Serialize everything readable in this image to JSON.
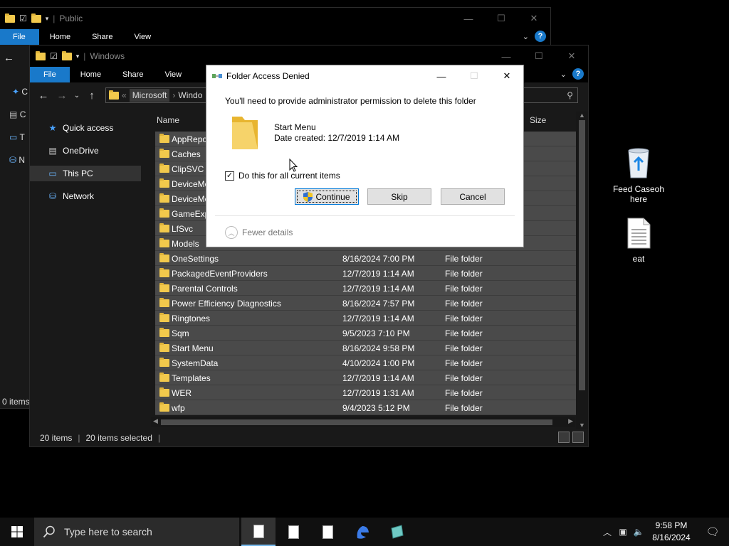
{
  "back_window": {
    "title": "Public",
    "ribbon": [
      "File",
      "Home",
      "Share",
      "View"
    ],
    "side_glyphs": [
      "C",
      "C",
      "T",
      "N"
    ],
    "status_text": "0 items"
  },
  "front_window": {
    "title": "Windows",
    "ribbon": [
      "File",
      "Home",
      "Share",
      "View"
    ],
    "address": {
      "sep": "«",
      "seg1": "Microsoft",
      "seg2": "Windo"
    },
    "nav": [
      {
        "label": "Quick access",
        "icon": "star-icon"
      },
      {
        "label": "OneDrive",
        "icon": "onedrive-icon"
      },
      {
        "label": "This PC",
        "icon": "pc-icon"
      },
      {
        "label": "Network",
        "icon": "network-icon"
      }
    ],
    "columns": {
      "name": "Name",
      "size": "Size"
    },
    "rows": [
      {
        "name": "AppRepo",
        "date": "",
        "type": ""
      },
      {
        "name": "Caches",
        "date": "",
        "type": ""
      },
      {
        "name": "ClipSVC",
        "date": "",
        "type": ""
      },
      {
        "name": "DeviceMe",
        "date": "",
        "type": ""
      },
      {
        "name": "DeviceMe",
        "date": "",
        "type": ""
      },
      {
        "name": "GameExp",
        "date": "",
        "type": ""
      },
      {
        "name": "LfSvc",
        "date": "",
        "type": ""
      },
      {
        "name": "Models",
        "date": "",
        "type": ""
      },
      {
        "name": "OneSettings",
        "date": "8/16/2024 7:00 PM",
        "type": "File folder"
      },
      {
        "name": "PackagedEventProviders",
        "date": "12/7/2019 1:14 AM",
        "type": "File folder"
      },
      {
        "name": "Parental Controls",
        "date": "12/7/2019 1:14 AM",
        "type": "File folder"
      },
      {
        "name": "Power Efficiency Diagnostics",
        "date": "8/16/2024 7:57 PM",
        "type": "File folder"
      },
      {
        "name": "Ringtones",
        "date": "12/7/2019 1:14 AM",
        "type": "File folder"
      },
      {
        "name": "Sqm",
        "date": "9/5/2023 7:10 PM",
        "type": "File folder"
      },
      {
        "name": "Start Menu",
        "date": "8/16/2024 9:58 PM",
        "type": "File folder"
      },
      {
        "name": "SystemData",
        "date": "4/10/2024 1:00 PM",
        "type": "File folder"
      },
      {
        "name": "Templates",
        "date": "12/7/2019 1:14 AM",
        "type": "File folder"
      },
      {
        "name": "WER",
        "date": "12/7/2019 1:31 AM",
        "type": "File folder"
      },
      {
        "name": "wfp",
        "date": "9/4/2023 5:12 PM",
        "type": "File folder"
      }
    ],
    "status": {
      "count": "20 items",
      "selected": "20 items selected",
      "sep": "|"
    }
  },
  "dialog": {
    "title": "Folder Access Denied",
    "message": "You'll need to provide administrator permission to delete this folder",
    "folder_name": "Start Menu",
    "date_created": "Date created: 12/7/2019 1:14 AM",
    "checkbox_label": "Do this for all current items",
    "checkbox_checked": true,
    "buttons": {
      "continue": "Continue",
      "skip": "Skip",
      "cancel": "Cancel"
    },
    "fewer_details": "Fewer details"
  },
  "desktop": {
    "icons": [
      {
        "label": "Feed Caseoh here",
        "icon": "recycle-bin-icon"
      },
      {
        "label": "eat",
        "icon": "text-file-icon"
      }
    ]
  },
  "taskbar": {
    "search_placeholder": "Type here to search",
    "time": "9:58 PM",
    "date": "8/16/2024"
  },
  "colors": {
    "accent": "#1979ca",
    "row_selected": "#4a4a4a",
    "folder": "#f2c94c"
  }
}
